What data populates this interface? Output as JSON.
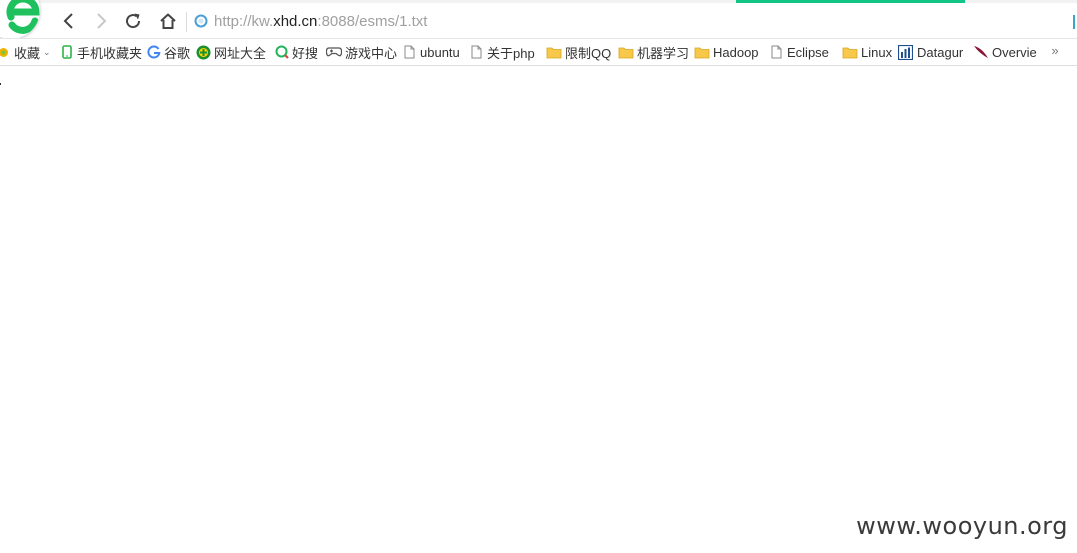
{
  "browser": {
    "url_prefix": "http://kw.",
    "url_host": "xhd.cn",
    "url_suffix": ":8088/esms/1.txt",
    "accent_color": "#12c486"
  },
  "toolbar": {
    "back_icon": "chevron-left-icon",
    "forward_icon": "chevron-right-icon",
    "refresh_icon": "refresh-icon",
    "home_icon": "home-icon"
  },
  "bookmarks": {
    "items": [
      {
        "label": "收藏",
        "icon": "favorites-icon"
      },
      {
        "label": "手机收藏夹",
        "icon": "phone-icon"
      },
      {
        "label": "谷歌",
        "icon": "google-icon"
      },
      {
        "label": "网址大全",
        "icon": "sites-icon"
      },
      {
        "label": "好搜",
        "icon": "haosou-icon"
      },
      {
        "label": "游戏中心",
        "icon": "gamepad-icon"
      },
      {
        "label": "ubuntu",
        "icon": "page-icon"
      },
      {
        "label": "关于php",
        "icon": "page-icon"
      },
      {
        "label": "限制QQ",
        "icon": "folder-icon"
      },
      {
        "label": "机器学习",
        "icon": "folder-icon"
      },
      {
        "label": "Hadoop",
        "icon": "folder-icon"
      },
      {
        "label": "Eclipse",
        "icon": "page-icon"
      },
      {
        "label": "Linux",
        "icon": "folder-icon"
      },
      {
        "label": "Datagur",
        "icon": "chart-icon"
      },
      {
        "label": "Overvie",
        "icon": "feather-icon"
      }
    ],
    "more_label": "»"
  },
  "watermark": "www.wooyun.org"
}
